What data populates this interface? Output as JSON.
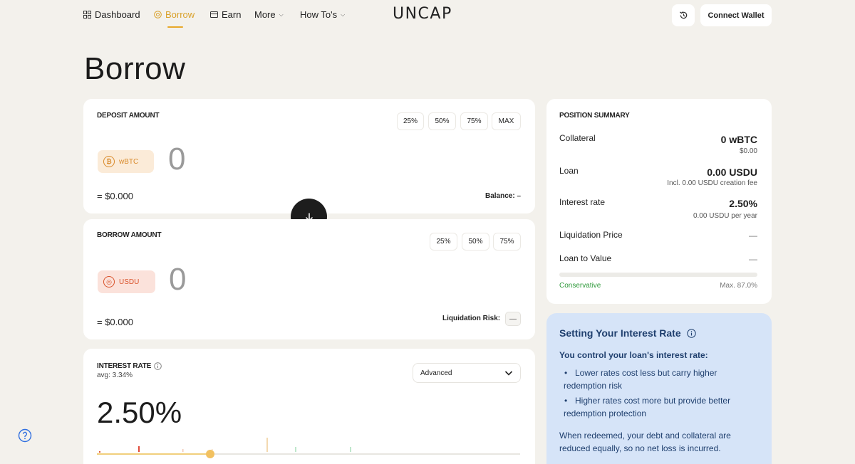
{
  "nav": {
    "items": [
      {
        "label": "Dashboard"
      },
      {
        "label": "Borrow"
      },
      {
        "label": "Earn"
      },
      {
        "label": "More"
      },
      {
        "label": "How To's"
      }
    ],
    "logo": "UNCAP",
    "connect_wallet": "Connect Wallet",
    "active_color": "#e8a829"
  },
  "page": {
    "title": "Borrow"
  },
  "deposit": {
    "label": "DEPOSIT AMOUNT",
    "pct_buttons": [
      "25%",
      "50%",
      "75%",
      "MAX"
    ],
    "token": "wBTC",
    "amount": "0",
    "usd_value": "= $0.000",
    "balance_label": "Balance:",
    "balance_value": "–"
  },
  "borrow": {
    "label": "BORROW AMOUNT",
    "pct_buttons": [
      "25%",
      "50%",
      "75%"
    ],
    "token": "USDU",
    "amount": "0",
    "usd_value": "= $0.000",
    "risk_label": "Liquidation Risk:",
    "risk_value": "—"
  },
  "interest": {
    "label": "INTEREST RATE",
    "avg": "avg: 3.34%",
    "mode": "Advanced",
    "rate": "2.50%",
    "slider_position": 0.32
  },
  "summary": {
    "title": "POSITION SUMMARY",
    "collateral_label": "Collateral",
    "collateral_value": "0 wBTC",
    "collateral_usd": "$0.00",
    "loan_label": "Loan",
    "loan_value": "0.00 USDU",
    "loan_fee": "Incl. 0.00 USDU creation fee",
    "rate_label": "Interest rate",
    "rate_value": "2.50%",
    "rate_sub": "0.00 USDU per year",
    "liq_label": "Liquidation Price",
    "liq_value": "—",
    "ltv_label": "Loan to Value",
    "ltv_value": "—",
    "ltv_min_label": "Conservative",
    "ltv_max_label": "Max. 87.0%"
  },
  "info": {
    "title": "Setting Your Interest Rate",
    "subtitle": "You control your loan's interest rate:",
    "bullets": [
      "Lower rates cost less but carry higher redemption risk",
      "Higher rates cost more but provide better redemption protection"
    ],
    "footer": "When redeemed, your debt and collateral are reduced equally, so no net loss is incurred."
  }
}
